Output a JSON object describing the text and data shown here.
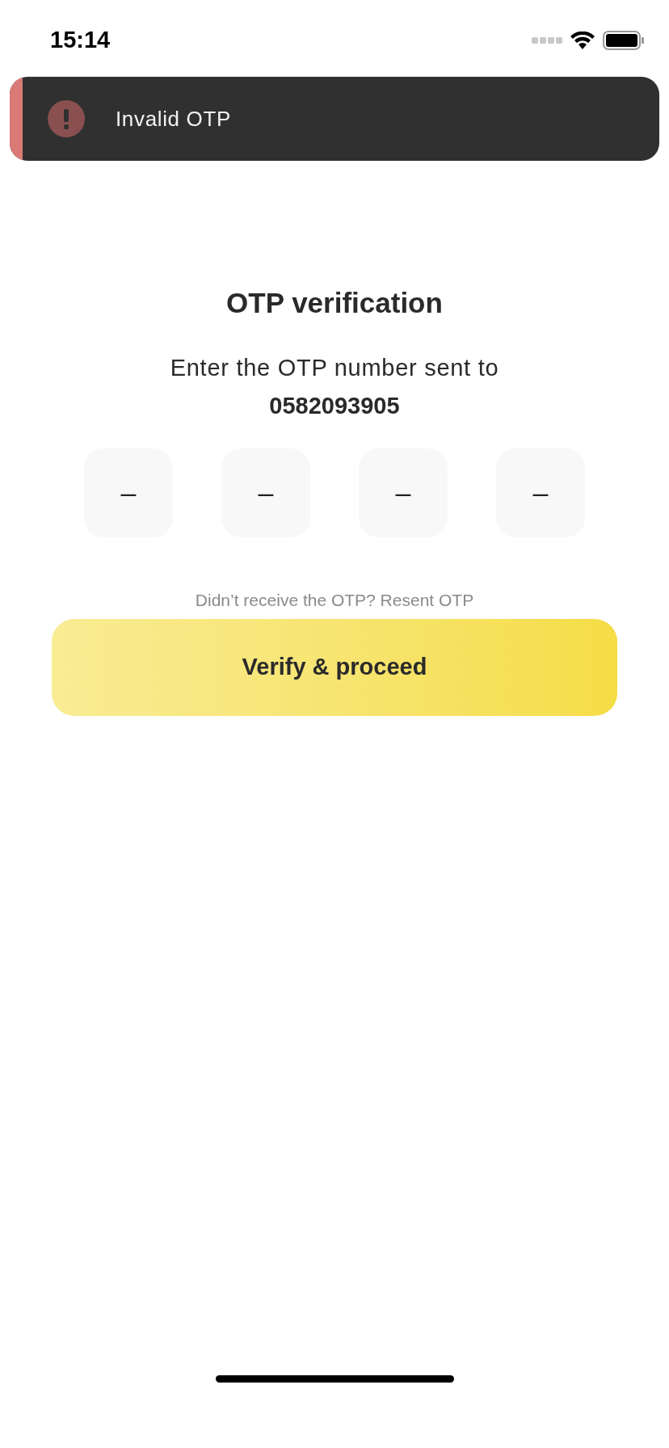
{
  "status_bar": {
    "time": "15:14"
  },
  "toast": {
    "kind": "error",
    "message": "Invalid OTP"
  },
  "title": "OTP verification",
  "subtitle": "Enter the OTP number sent to",
  "phone": "0582093905",
  "otp_fields": [
    {
      "placeholder": "–"
    },
    {
      "placeholder": "–"
    },
    {
      "placeholder": "–"
    },
    {
      "placeholder": "–"
    }
  ],
  "resend_hint": "Didn’t receive the OTP? Resent OTP",
  "primary_button": "Verify & proceed"
}
